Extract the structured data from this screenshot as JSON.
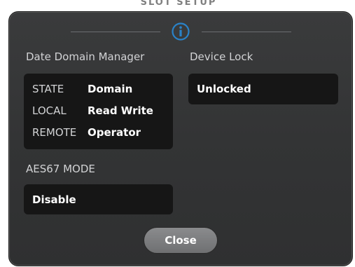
{
  "background": {
    "partial_title": "SLOT SETUP"
  },
  "dialog": {
    "icon": "info-icon",
    "accent_color": "#2a82c8",
    "domain_manager": {
      "label": "Date Domain Manager",
      "rows": [
        {
          "key": "STATE",
          "value": "Domain"
        },
        {
          "key": "LOCAL",
          "value": "Read Write"
        },
        {
          "key": "REMOTE",
          "value": "Operator"
        }
      ]
    },
    "device_lock": {
      "label": "Device Lock",
      "value": "Unlocked"
    },
    "aes67": {
      "label": "AES67 MODE",
      "value": "Disable"
    },
    "close_label": "Close"
  }
}
